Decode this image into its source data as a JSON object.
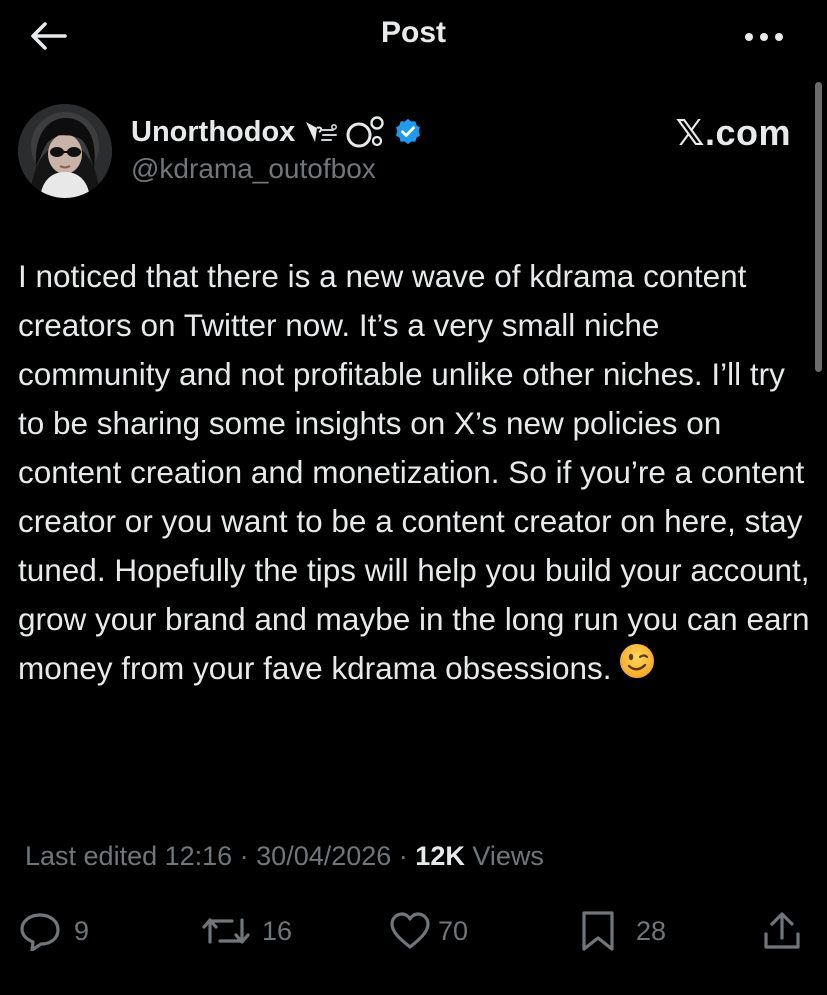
{
  "header": {
    "title": "Post",
    "back_icon": "arrow-left-icon",
    "more_icon": "more-horizontal-icon"
  },
  "author": {
    "display_name": "Unorthodox",
    "handle": "@kdrama_outofbox",
    "name_emoji": [
      "wind-blowing-icon",
      "bubbles-icon"
    ],
    "verified_icon": "verified-badge-icon",
    "verified_color": "#1d9bf0"
  },
  "brand": "𝕏.com",
  "post": {
    "text": "I noticed that there is a new wave of kdrama content creators on Twitter now. It’s a very small niche community and not profitable unlike other niches. I’ll try to be sharing some insights on X’s new policies on content creation and monetization. So if you’re a content creator or you want to be a content creator on here, stay tuned. Hopefully the tips will help you build your account, grow your brand and maybe in the long run you can earn money from your fave kdrama obsessions.",
    "emoji": "winking-face-icon"
  },
  "meta": {
    "edited_label": "Last edited 12:16 · 30/04/2026 · ",
    "views_count": "12K",
    "views_label": " Views"
  },
  "actions": {
    "replies": "9",
    "reposts": "16",
    "likes": "70",
    "bookmarks": "28"
  },
  "colors": {
    "background": "#000000",
    "text_primary": "#e7e9ea",
    "text_secondary": "#71767b",
    "accent": "#1d9bf0"
  }
}
